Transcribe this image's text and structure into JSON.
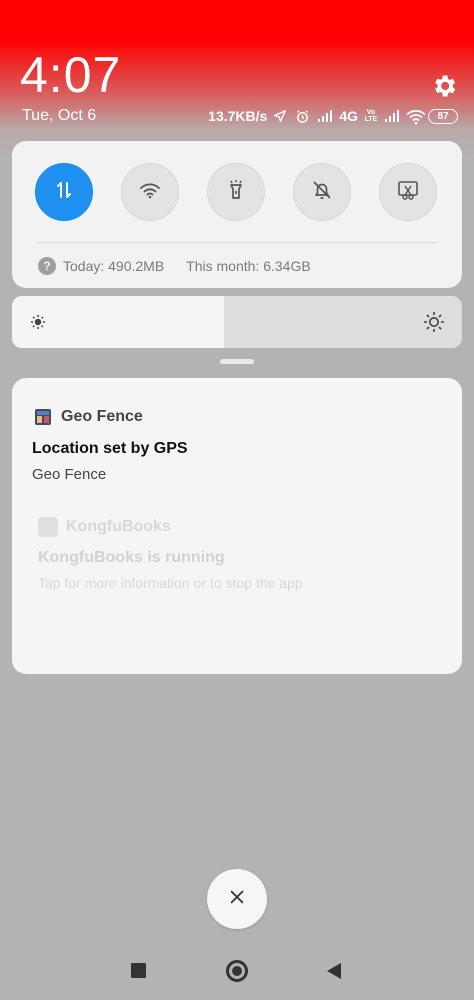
{
  "header": {
    "time": "4:07",
    "date": "Tue, Oct 6",
    "net_speed": "13.7KB/s",
    "network_type": "4G",
    "volte_label": "Vo LTE",
    "battery": "87"
  },
  "quick_settings": {
    "tiles": [
      {
        "name": "mobile-data",
        "icon": "data-arrows-icon",
        "active": true
      },
      {
        "name": "wifi",
        "icon": "wifi-icon",
        "active": false
      },
      {
        "name": "flashlight",
        "icon": "flashlight-icon",
        "active": false
      },
      {
        "name": "mute",
        "icon": "bell-off-icon",
        "active": false
      },
      {
        "name": "screenshot",
        "icon": "scissors-screenshot-icon",
        "active": false
      }
    ],
    "data_today": "Today: 490.2MB",
    "data_month": "This month: 6.34GB"
  },
  "brightness": {
    "level": 0.47
  },
  "notifications": [
    {
      "app": "Geo Fence",
      "title": "Location set by GPS",
      "text": "Geo Fence"
    },
    {
      "app": "KongfuBooks",
      "title": "KongfuBooks is running",
      "text": "Tap for more information or to stop the app"
    }
  ],
  "colors": {
    "accent": "#1f8ff0",
    "header_red": "#ff0000"
  }
}
